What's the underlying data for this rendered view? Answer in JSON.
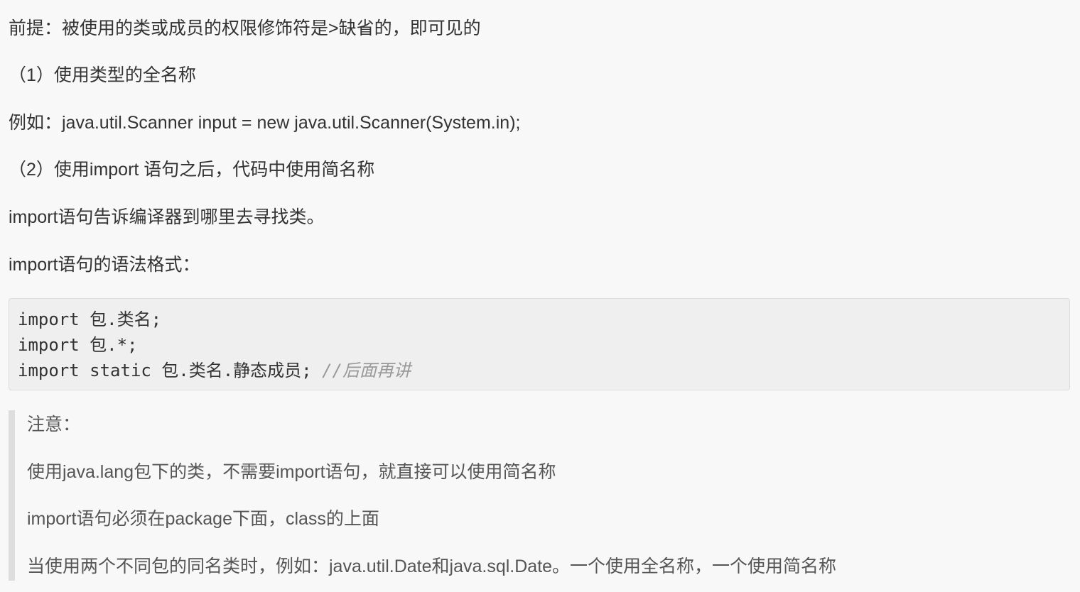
{
  "paragraphs": [
    "前提：被使用的类或成员的权限修饰符是>缺省的，即可见的",
    "（1）使用类型的全名称",
    "例如：java.util.Scanner input = new java.util.Scanner(System.in);",
    "（2）使用import 语句之后，代码中使用简名称",
    "import语句告诉编译器到哪里去寻找类。",
    "import语句的语法格式："
  ],
  "code": {
    "line1": "import 包.类名;",
    "line2": "import 包.*;",
    "line3": "import static 包.类名.静态成员; ",
    "line3_comment": "//后面再讲"
  },
  "note": {
    "title": "注意：",
    "items": [
      "使用java.lang包下的类，不需要import语句，就直接可以使用简名称",
      "import语句必须在package下面，class的上面",
      "当使用两个不同包的同名类时，例如：java.util.Date和java.sql.Date。一个使用全名称，一个使用简名称"
    ]
  },
  "colors": {
    "text": "#333333",
    "note_text": "#555555",
    "code_background": "#efefef",
    "quote_bar": "#dddddd",
    "comment": "#999999",
    "page_background": "#f8f8f8"
  }
}
